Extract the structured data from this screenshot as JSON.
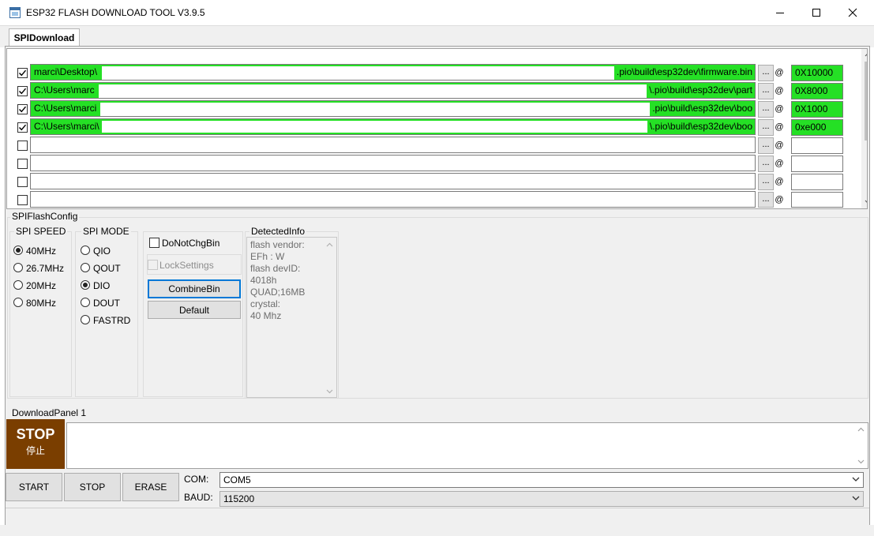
{
  "window": {
    "title": "ESP32 FLASH DOWNLOAD TOOL V3.9.5"
  },
  "tabs": [
    {
      "label": "SPIDownload",
      "active": true
    }
  ],
  "files": [
    {
      "checked": true,
      "path_left": "marci\\Desktop\\",
      "path_right": ".pio\\build\\esp32dev\\firmware.bin",
      "address": "0X10000"
    },
    {
      "checked": true,
      "path_left": "C:\\Users\\marc",
      "path_right": "\\.pio\\build\\esp32dev\\part",
      "address": "0X8000"
    },
    {
      "checked": true,
      "path_left": "C:\\Users\\marci",
      "path_right": ".pio\\build\\esp32dev\\boo",
      "address": "0X1000"
    },
    {
      "checked": true,
      "path_left": "C:\\Users\\marci\\",
      "path_right": "\\.pio\\build\\esp32dev\\boo",
      "address": "0xe000"
    },
    {
      "checked": false,
      "path_left": "",
      "path_right": "",
      "address": ""
    },
    {
      "checked": false,
      "path_left": "",
      "path_right": "",
      "address": ""
    },
    {
      "checked": false,
      "path_left": "",
      "path_right": "",
      "address": ""
    },
    {
      "checked": false,
      "path_left": "",
      "path_right": "",
      "address": ""
    }
  ],
  "browse_label": "...",
  "at_symbol": "@",
  "spi_flash_config": {
    "title": "SPIFlashConfig",
    "spi_speed": {
      "title": "SPI SPEED",
      "options": [
        "40MHz",
        "26.7MHz",
        "20MHz",
        "80MHz"
      ],
      "selected": "40MHz"
    },
    "spi_mode": {
      "title": "SPI MODE",
      "options": [
        "QIO",
        "QOUT",
        "DIO",
        "DOUT",
        "FASTRD"
      ],
      "selected": "DIO"
    },
    "do_not_chg_bin": {
      "label": "DoNotChgBin",
      "checked": false
    },
    "lock_settings": {
      "label": "LockSettings",
      "checked": false,
      "disabled": true
    },
    "combine_bin_label": "CombineBin",
    "default_label": "Default",
    "detected_info": {
      "title": "DetectedInfo",
      "lines": [
        "flash vendor:",
        "EFh : W",
        "flash devID:",
        "4018h",
        "QUAD;16MB",
        "crystal:",
        "40 Mhz"
      ]
    }
  },
  "download_panel": {
    "title": "DownloadPanel 1",
    "status_en": "STOP",
    "status_cn": "停止",
    "status_color": "#7a3e00",
    "log_text": "",
    "buttons": {
      "start": "START",
      "stop": "STOP",
      "erase": "ERASE"
    },
    "com_label": "COM:",
    "com_value": "COM5",
    "baud_label": "BAUD:",
    "baud_value": "115200"
  },
  "colors": {
    "highlight_green": "#25e025",
    "focus_blue": "#0078d7"
  }
}
